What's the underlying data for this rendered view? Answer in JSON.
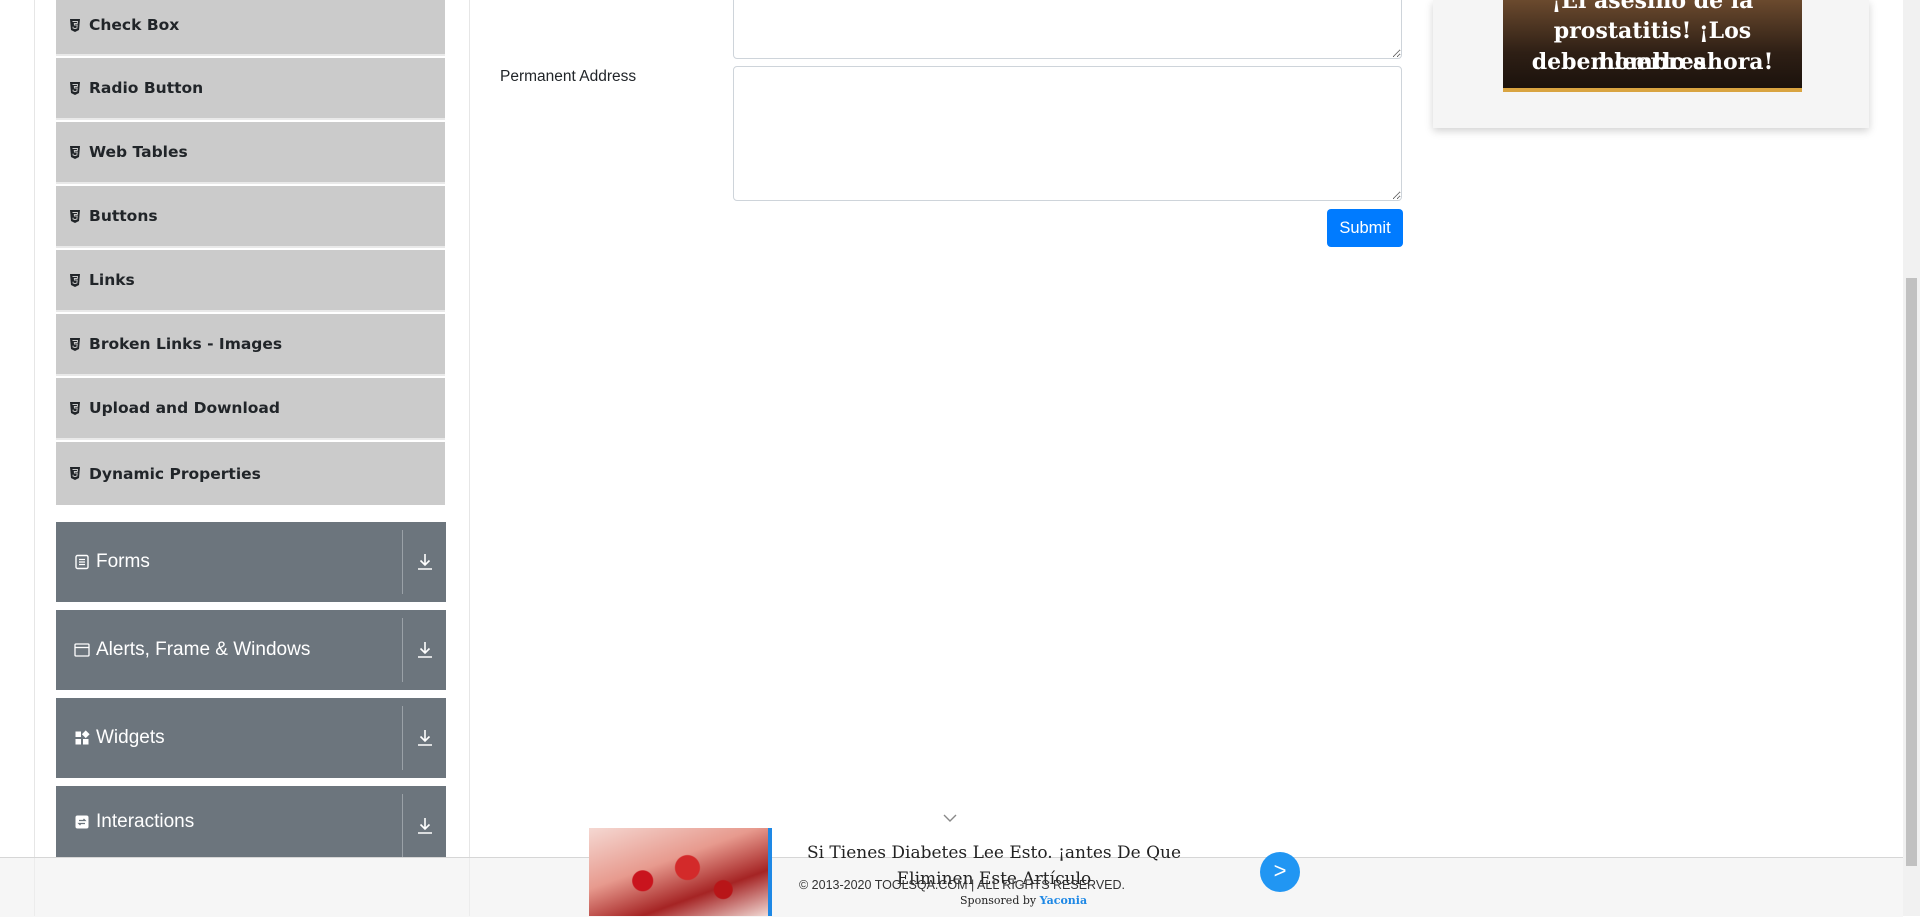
{
  "sidebar": {
    "items": [
      {
        "label": "Check Box",
        "top": 0
      },
      {
        "label": "Radio Button"
      },
      {
        "label": "Web Tables"
      },
      {
        "label": "Buttons"
      },
      {
        "label": "Links"
      },
      {
        "label": "Broken Links - Images"
      },
      {
        "label": "Upload and Download"
      },
      {
        "label": "Dynamic Properties"
      }
    ],
    "groups": [
      {
        "label": "Forms",
        "icon": "form-icon"
      },
      {
        "label": "Alerts, Frame & Windows",
        "icon": "window-icon"
      },
      {
        "label": "Widgets",
        "icon": "widgets-icon"
      },
      {
        "label": "Interactions",
        "icon": "interactions-icon"
      }
    ]
  },
  "form": {
    "permanent_address_label": "Permanent Address",
    "current_address_value": "",
    "permanent_address_value": "",
    "submit_label": "Submit"
  },
  "ad_right": {
    "lines": [
      "¡El asesino de la",
      "prostatitis! ¡Los hombres",
      "deben leerlo ahora!"
    ]
  },
  "ad_bottom": {
    "headline": "Si Tienes Diabetes Lee Esto. ¡antes De Que Eliminen Este Artículo",
    "go_label": ">",
    "sponsored_prefix": "Sponsored by",
    "sponsor_name": "Yaconia"
  },
  "footer": {
    "copyright": "© 2013-2020 TOOLSQA.COM | ALL RIGHTS RESERVED."
  },
  "colors": {
    "sidebar_item_bg": "#cbcbcb",
    "group_bg": "#6c757d",
    "primary": "#007bff"
  }
}
